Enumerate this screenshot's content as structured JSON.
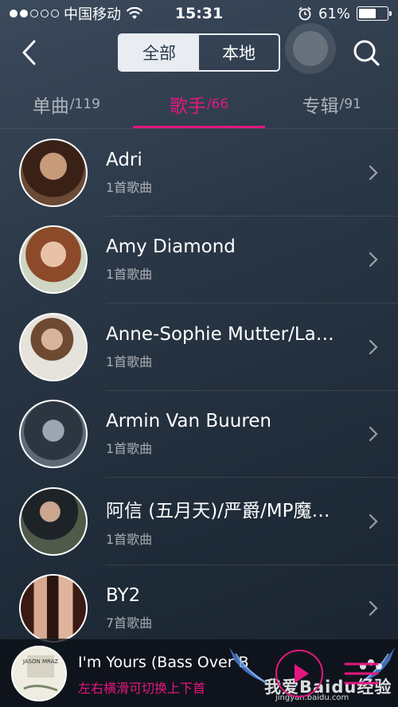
{
  "status_bar": {
    "carrier": "中国移动",
    "time": "15:31",
    "battery": "61%",
    "battery_level": 0.61
  },
  "nav": {
    "segments": [
      {
        "label": "全部",
        "active": true
      },
      {
        "label": "本地",
        "active": false
      }
    ],
    "back_icon": "chevron-left-icon",
    "search_icon": "search-icon"
  },
  "tabs": [
    {
      "label": "单曲",
      "count": "/119",
      "active": false
    },
    {
      "label": "歌手",
      "count": "/66",
      "active": true
    },
    {
      "label": "专辑",
      "count": "/91",
      "active": false
    }
  ],
  "artists": [
    {
      "name": "Adri",
      "songs": "1首歌曲"
    },
    {
      "name": "Amy Diamond",
      "songs": "1首歌曲"
    },
    {
      "name": "Anne-Sophie Mutter/Lam…",
      "songs": "1首歌曲"
    },
    {
      "name": "Armin Van Buuren",
      "songs": "1首歌曲"
    },
    {
      "name": "阿信 (五月天)/严爵/MP魔…",
      "songs": "1首歌曲"
    },
    {
      "name": "BY2",
      "songs": "7首歌曲"
    }
  ],
  "player": {
    "title": "I'm Yours (Bass Over B",
    "hint": "左右横滑可切换上下首",
    "album_text": "JASON MRAZ"
  },
  "watermark": {
    "text": "我爱Baidu经验",
    "url": "jingyan.baidu.com"
  },
  "colors": {
    "accent": "#e4177f",
    "background": "#2a3746"
  }
}
